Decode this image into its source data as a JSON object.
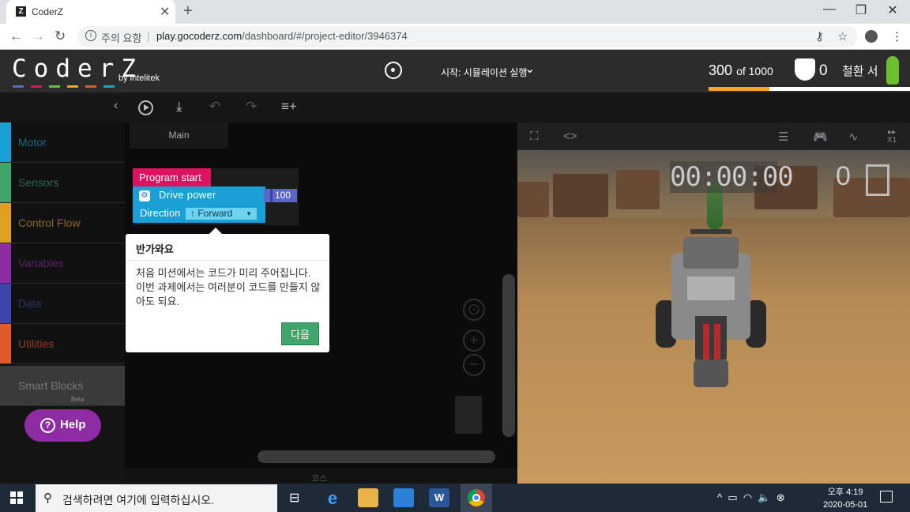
{
  "browser": {
    "tab_title": "CoderZ",
    "tab_favicon": "Z",
    "tab_close": "✕",
    "new_tab": "+",
    "window_controls": [
      "—",
      "❐",
      "✕"
    ],
    "security_warning": "주의 요함",
    "url_host": "play.gocoderz.com",
    "url_path": "/dashboard/#/project-editor/3946374"
  },
  "app": {
    "logo_text": "CoderZ",
    "logo_sub": "by intelitek",
    "logo_underline_colors": [
      "#5b67c8",
      "#e0115f",
      "#6cbf2e",
      "#f5a623",
      "#e05a2b",
      "#1aa0d5"
    ],
    "run_label": "시작: 시뮬레이션 실행",
    "score_value": "300",
    "score_suffix": "of 1000",
    "score_progress": 0.3,
    "accent_color": "#f5a623",
    "shield_count": "0",
    "user_name": "철환 서"
  },
  "sidebar": {
    "categories": [
      {
        "label": "Motor",
        "color": "#1aa0d5"
      },
      {
        "label": "Sensors",
        "color": "#3fa56a"
      },
      {
        "label": "Control Flow",
        "color": "#e0a021"
      },
      {
        "label": "Variables",
        "color": "#8e2ca3"
      },
      {
        "label": "Data",
        "color": "#3b47a8"
      },
      {
        "label": "Utilities",
        "color": "#e05a2b"
      }
    ],
    "smart_blocks": "Smart Blocks",
    "beta": "Beta",
    "help": "Help"
  },
  "workspace": {
    "tab_main": "Main",
    "block_program_start": "Program start",
    "block_drive": "Drive  power",
    "block_power_value": "100",
    "block_direction": "Direction",
    "block_direction_value": "↑ Forward",
    "bottom_label": "코스"
  },
  "tooltip": {
    "title": "반가와요",
    "body": "처음 미션에서는 코드가 미리 주어집니다. 이번 과제에서는 여러분이 코드를 만들지 않아도 되요.",
    "next": "다음"
  },
  "sim": {
    "timer": "00:00:00",
    "score": "0",
    "speed": "X1"
  },
  "taskbar": {
    "search_placeholder": "검색하려면 여기에 입력하십시오.",
    "time": "오후 4:19",
    "date": "2020-05-01"
  }
}
